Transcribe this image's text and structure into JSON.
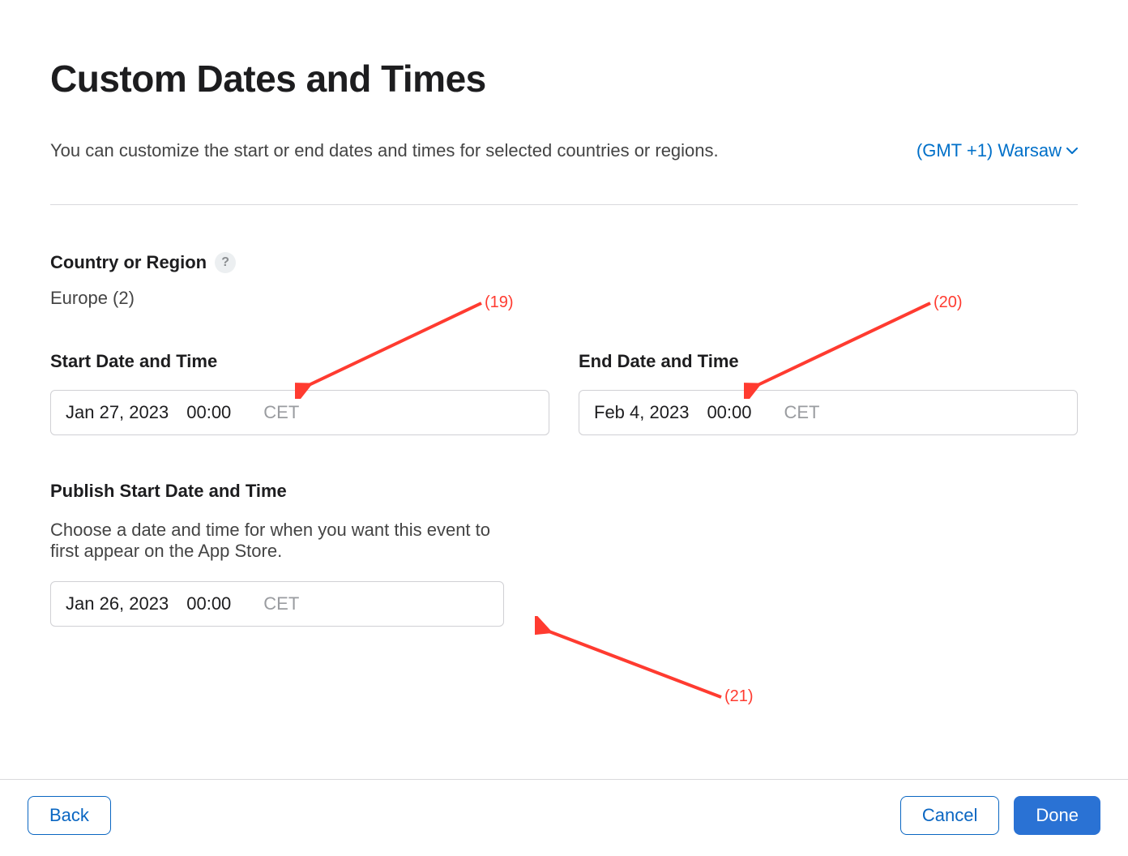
{
  "title": "Custom Dates and Times",
  "intro": "You can customize the start or end dates and times for selected countries or regions.",
  "timezone_label": "(GMT +1) Warsaw",
  "region": {
    "label": "Country or Region",
    "value": "Europe (2)"
  },
  "fields": {
    "start": {
      "label": "Start Date and Time",
      "date": "Jan 27, 2023",
      "time": "00:00",
      "zone": "CET"
    },
    "end": {
      "label": "End Date and Time",
      "date": "Feb 4, 2023",
      "time": "00:00",
      "zone": "CET"
    },
    "publish": {
      "label": "Publish Start Date and Time",
      "desc": "Choose a date and time for when you want this event to first appear on the App Store.",
      "date": "Jan 26, 2023",
      "time": "00:00",
      "zone": "CET"
    }
  },
  "buttons": {
    "back": "Back",
    "cancel": "Cancel",
    "done": "Done"
  },
  "annotations": {
    "a19": "(19)",
    "a20": "(20)",
    "a21": "(21)"
  }
}
